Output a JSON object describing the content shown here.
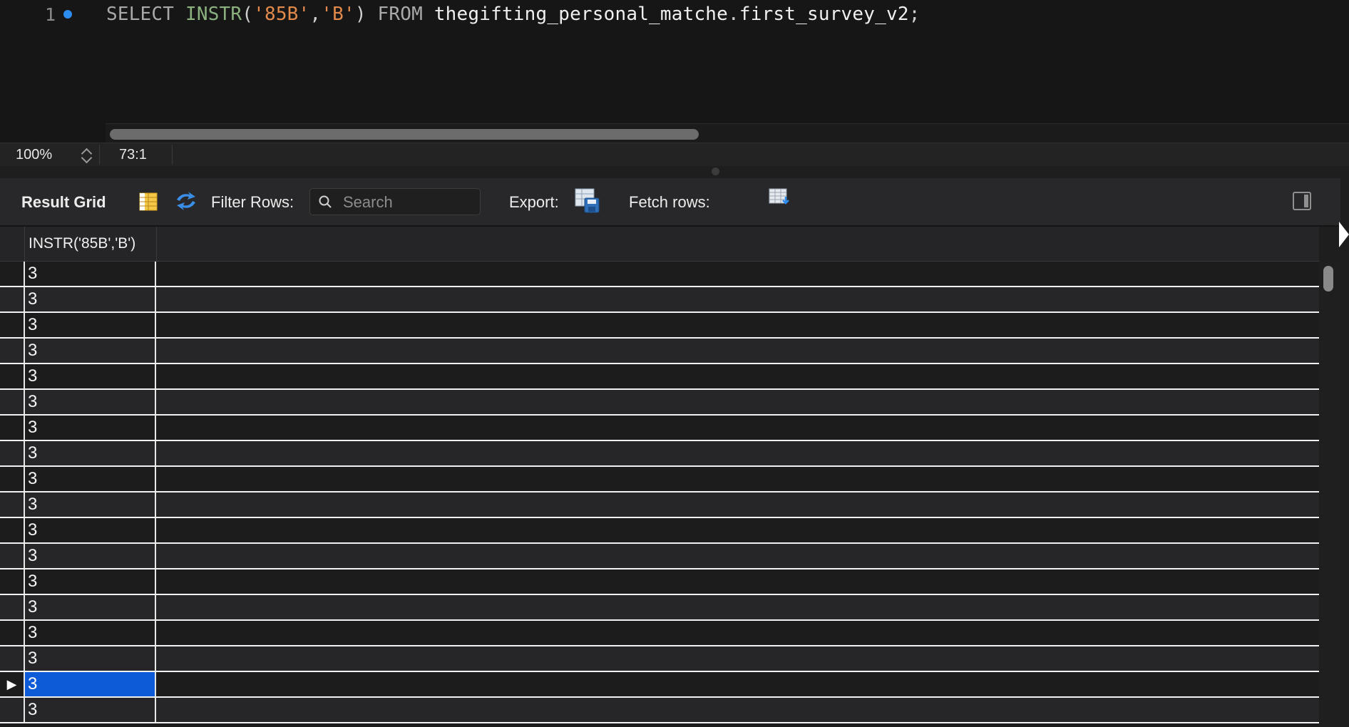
{
  "editor": {
    "line_number": "1",
    "sql": {
      "kw_select": "SELECT",
      "fn_instr": "INSTR",
      "paren_open": "(",
      "arg1": "'85B'",
      "comma": ",",
      "arg2": "'B'",
      "paren_close": ")",
      "kw_from": "FROM",
      "schema": "thegifting_personal_matche",
      "dot": ".",
      "table": "first_survey_v2",
      "semicolon": ";"
    }
  },
  "status": {
    "zoom": "100%",
    "cursor_position": "73:1"
  },
  "toolbar": {
    "title": "Result Grid",
    "filter_label": "Filter Rows:",
    "search_placeholder": "Search",
    "export_label": "Export:",
    "fetch_label": "Fetch rows:"
  },
  "grid": {
    "columns": [
      "INSTR('85B','B')"
    ],
    "rows": [
      {
        "value": "3",
        "indicator": ""
      },
      {
        "value": "3",
        "indicator": ""
      },
      {
        "value": "3",
        "indicator": ""
      },
      {
        "value": "3",
        "indicator": ""
      },
      {
        "value": "3",
        "indicator": ""
      },
      {
        "value": "3",
        "indicator": ""
      },
      {
        "value": "3",
        "indicator": ""
      },
      {
        "value": "3",
        "indicator": ""
      },
      {
        "value": "3",
        "indicator": ""
      },
      {
        "value": "3",
        "indicator": ""
      },
      {
        "value": "3",
        "indicator": ""
      },
      {
        "value": "3",
        "indicator": ""
      },
      {
        "value": "3",
        "indicator": ""
      },
      {
        "value": "3",
        "indicator": ""
      },
      {
        "value": "3",
        "indicator": ""
      },
      {
        "value": "3",
        "indicator": ""
      },
      {
        "value": "3",
        "indicator": "▶",
        "selected": true
      },
      {
        "value": "3",
        "indicator": ""
      }
    ]
  },
  "colors": {
    "selection": "#0d5bd6",
    "accent": "#2d8cf0",
    "keyword": "#a9a9a9",
    "function": "#8ab17e",
    "string": "#e3894a"
  },
  "icons": [
    "exec-dot-icon",
    "grid-layout-icon",
    "refresh-icon",
    "search-icon",
    "export-icon",
    "fetch-rows-icon",
    "panel-toggle-icon",
    "row-pointer-icon"
  ]
}
